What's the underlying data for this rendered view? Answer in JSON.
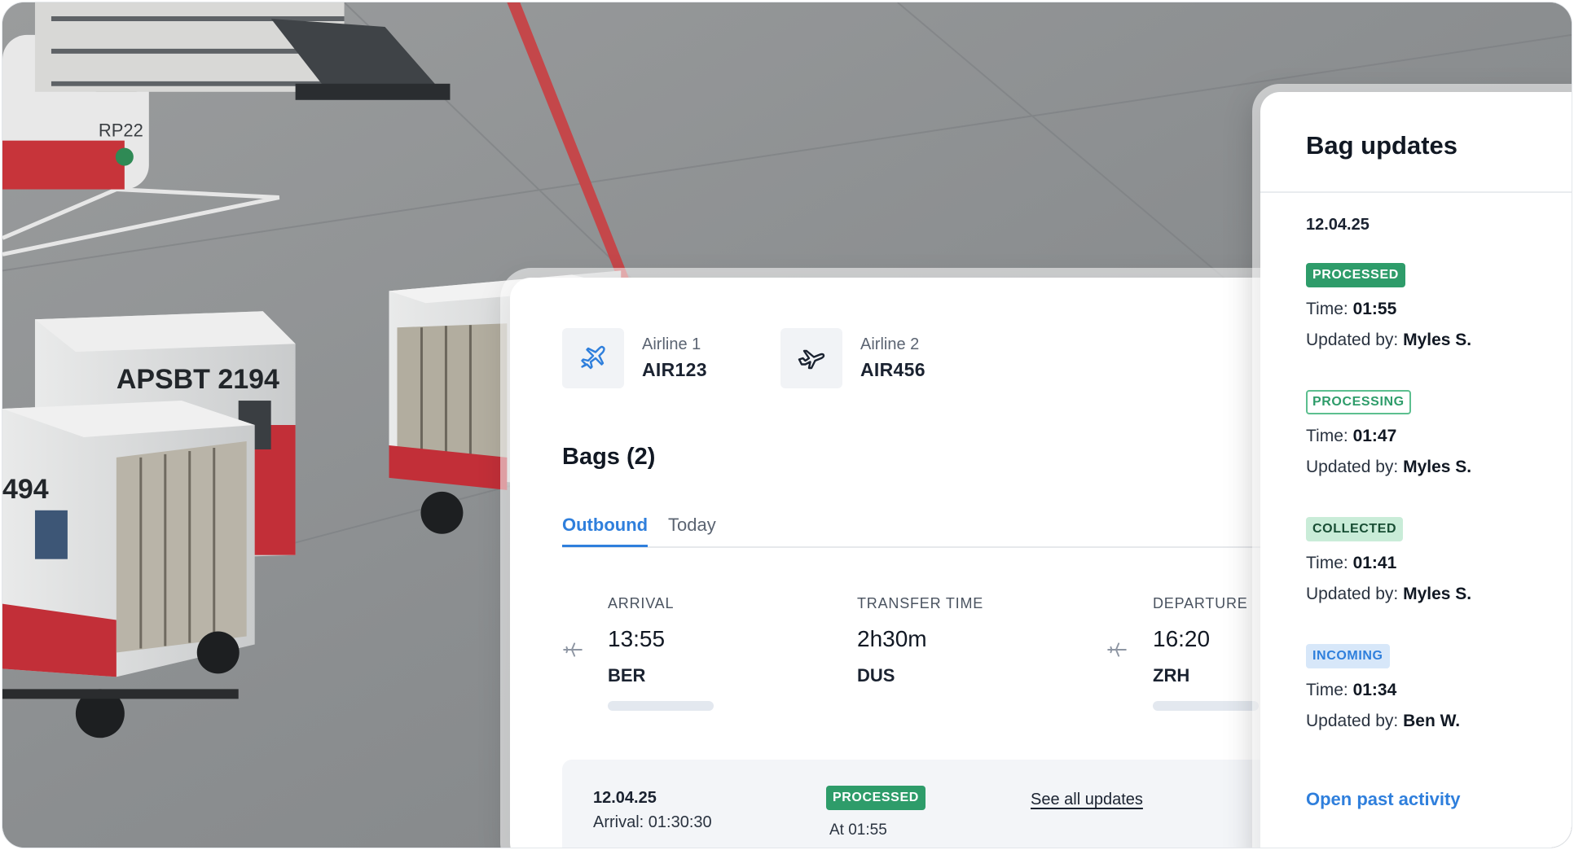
{
  "airlines": [
    {
      "label": "Airline 1",
      "code": "AIR123",
      "icon": "plane-takeoff-icon"
    },
    {
      "label": "Airline 2",
      "code": "AIR456",
      "icon": "plane-icon"
    }
  ],
  "bags": {
    "title": "Bags (2)",
    "tabs": [
      {
        "label": "Outbound",
        "active": true
      },
      {
        "label": "Today",
        "active": false
      }
    ],
    "route": {
      "arrival": {
        "label": "ARRIVAL",
        "time": "13:55",
        "code": "BER"
      },
      "transfer": {
        "label": "TRANSFER TIME",
        "time": "2h30m",
        "code": "DUS"
      },
      "departure": {
        "label": "DEPARTURE",
        "time": "16:20",
        "code": "ZRH"
      }
    },
    "summary": {
      "date": "12.04.25",
      "arrival": "Arrival: 01:30:30",
      "status": "PROCESSED",
      "at": "At 01:55",
      "link": "See all updates"
    }
  },
  "updates": {
    "title": "Bag updates",
    "date": "12.04.25",
    "entries": [
      {
        "status": "PROCESSED",
        "time_label": "Time: ",
        "time": "01:55",
        "by_label": "Updated by: ",
        "by": "Myles S."
      },
      {
        "status": "PROCESSING",
        "time_label": "Time: ",
        "time": "01:47",
        "by_label": "Updated by: ",
        "by": "Myles S."
      },
      {
        "status": "COLLECTED",
        "time_label": "Time: ",
        "time": "01:41",
        "by_label": "Updated by: ",
        "by": "Myles S."
      },
      {
        "status": "INCOMING",
        "time_label": "Time: ",
        "time": "01:34",
        "by_label": "Updated by: ",
        "by": "Ben W."
      }
    ],
    "open_link": "Open past activity"
  },
  "photo": {
    "container_labels": [
      "APSBT 2194",
      "494",
      "RP22"
    ]
  },
  "colors": {
    "accent": "#2f7fdc",
    "processed": "#2e9c6a",
    "collected_bg": "#c9ecd8",
    "incoming_bg": "#d7e7f9"
  }
}
